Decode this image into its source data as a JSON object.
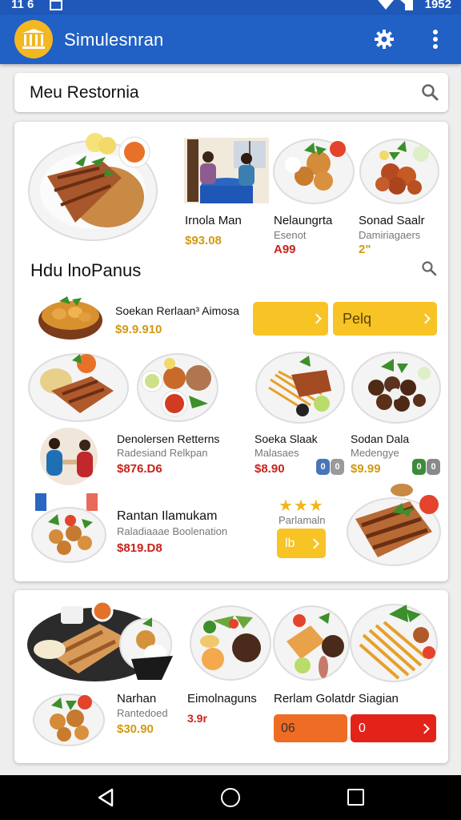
{
  "status_bar": {
    "time_left": "11 6",
    "time_right": "1952"
  },
  "app_bar": {
    "title": "Simulesnran",
    "logo_icon": "columns-icon",
    "action_icon": "gear-icon",
    "menu_icon": "more-vert-icon"
  },
  "search": {
    "title": "Meu Restornia",
    "icon": "search-icon"
  },
  "top_items": [
    {
      "name": "Irnola Man",
      "sub": "",
      "price": "$93.08"
    },
    {
      "name": "Nelaungrta",
      "sub": "Esenot",
      "price": "A99"
    },
    {
      "name": "Sonad Saalr",
      "sub": "Damiriagaers",
      "price": "2\""
    }
  ],
  "section": {
    "title": "Hdu lnoPanus",
    "icon": "search-icon"
  },
  "row1": {
    "name": "Soekan Rerlaan³ Aimosa",
    "price": "$9.9.910",
    "button_left": "",
    "button_right": "Pelq"
  },
  "row3": [
    {
      "name": "Denolersen Retterns",
      "sub": "Radesiand Relkpan",
      "price": "$876.D6"
    },
    {
      "name": "Soeka Slaak",
      "sub": "Malasaes",
      "price": "$8.90"
    },
    {
      "name": "Sodan Dala",
      "sub": "Medengye",
      "price": "$9.99"
    }
  ],
  "row4": {
    "name": "Rantan Ilamukam",
    "sub": "Raladiaaae Boolenation",
    "price": "$819.D8",
    "rating_stars": 3,
    "rating_label": "Parlamaln",
    "button": "lb"
  },
  "bottom_items": [
    {
      "name": "Narhan",
      "sub": "Rantedoed",
      "price": "$30.90"
    },
    {
      "name": "Eimolnaguns",
      "price": "3.9r"
    },
    {
      "name": "Rerlam Golatdr Siagian"
    }
  ],
  "bottom_buttons": {
    "orange": "06",
    "red": "0"
  },
  "nav_bar": {
    "back_icon": "back-triangle-icon",
    "home_icon": "home-circle-icon",
    "recent_icon": "recents-square-icon"
  }
}
